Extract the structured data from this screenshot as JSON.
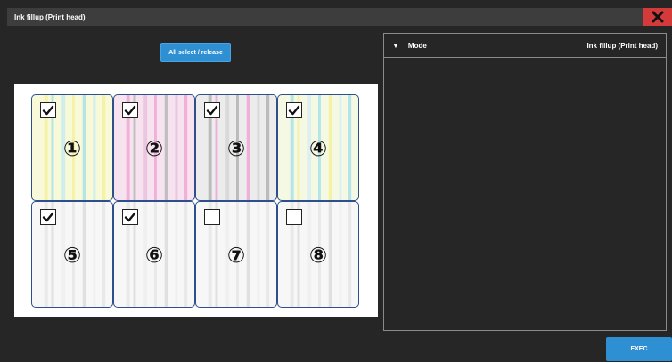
{
  "window": {
    "title": "Ink fillup (Print head)"
  },
  "toolbar": {
    "select_all_label": "All select / release"
  },
  "heads": [
    {
      "number": "①",
      "checked": true,
      "stripe_colors": [
        "#f5f19c",
        "#a7e2ea",
        "#c8ecf1"
      ],
      "tint": "#f7f9d8"
    },
    {
      "number": "②",
      "checked": true,
      "stripe_colors": [
        "#f0a7d3",
        "#b7b7b7",
        "#e9c1dc"
      ],
      "tint": "#f7e3ef"
    },
    {
      "number": "③",
      "checked": true,
      "stripe_colors": [
        "#b3b3b3",
        "#f0a7d3",
        "#d6d6d6"
      ],
      "tint": "#ececec"
    },
    {
      "number": "④",
      "checked": true,
      "stripe_colors": [
        "#a7e2ea",
        "#f5f19c",
        "#d8eef1"
      ],
      "tint": "#f5f9e4"
    },
    {
      "number": "⑤",
      "checked": true,
      "stripe_colors": [
        "#e6e6e6",
        "#dcdcdc",
        "#eeeeee"
      ],
      "tint": "#f7f7f7"
    },
    {
      "number": "⑥",
      "checked": true,
      "stripe_colors": [
        "#e6e6e6",
        "#dcdcdc",
        "#eeeeee"
      ],
      "tint": "#f7f7f7"
    },
    {
      "number": "⑦",
      "checked": false,
      "stripe_colors": [
        "#e6e6e6",
        "#dcdcdc",
        "#eeeeee"
      ],
      "tint": "#f7f7f7"
    },
    {
      "number": "⑧",
      "checked": false,
      "stripe_colors": [
        "#e6e6e6",
        "#dcdcdc",
        "#eeeeee"
      ],
      "tint": "#f7f7f7"
    }
  ],
  "mode_panel": {
    "header_label": "Mode",
    "header_value": "Ink fillup (Print head)"
  },
  "footer": {
    "exec_label": "EXEC"
  },
  "colors": {
    "background": "#262626",
    "titlebar": "#3d3d3d",
    "close": "#d43a3a",
    "accent": "#2e8fd3",
    "cell_border": "#2f4f8a"
  },
  "icons": {
    "close": "close-icon",
    "collapse": "triangle-down-icon",
    "check": "checkmark-icon"
  }
}
